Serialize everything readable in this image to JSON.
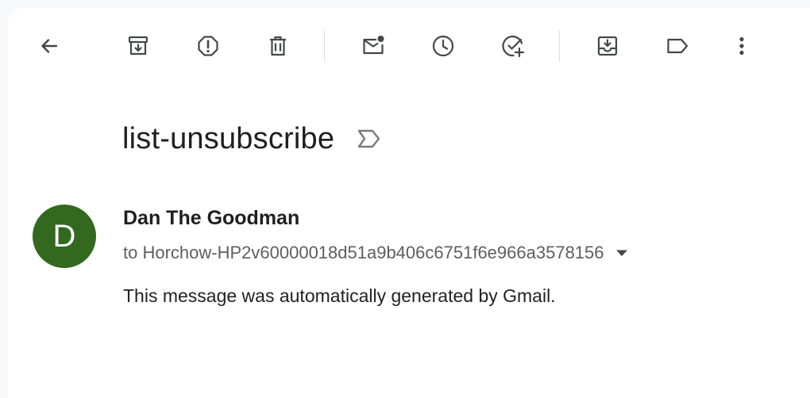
{
  "toolbar": {
    "icon_color": "#444746",
    "buttons": [
      {
        "id": "back",
        "icon": "back-arrow-icon"
      },
      {
        "id": "archive",
        "icon": "archive-icon"
      },
      {
        "id": "report-spam",
        "icon": "report-spam-icon"
      },
      {
        "id": "delete",
        "icon": "trash-icon"
      },
      {
        "id": "mark-unread",
        "icon": "mark-unread-icon"
      },
      {
        "id": "snooze",
        "icon": "clock-icon"
      },
      {
        "id": "add-to-tasks",
        "icon": "add-task-icon"
      },
      {
        "id": "move-to",
        "icon": "move-to-inbox-icon"
      },
      {
        "id": "labels",
        "icon": "label-icon"
      },
      {
        "id": "more",
        "icon": "more-vert-icon"
      }
    ]
  },
  "message": {
    "subject": "list-unsubscribe",
    "importance_icon": "importance-marker-icon",
    "sender": {
      "name": "Dan The Goodman",
      "avatar_letter": "D",
      "avatar_color": "#33691e"
    },
    "recipient_line": "to Horchow-HP2v60000018d51a9b406c6751f6e966a3578156",
    "body": "This message was automatically generated by Gmail."
  }
}
